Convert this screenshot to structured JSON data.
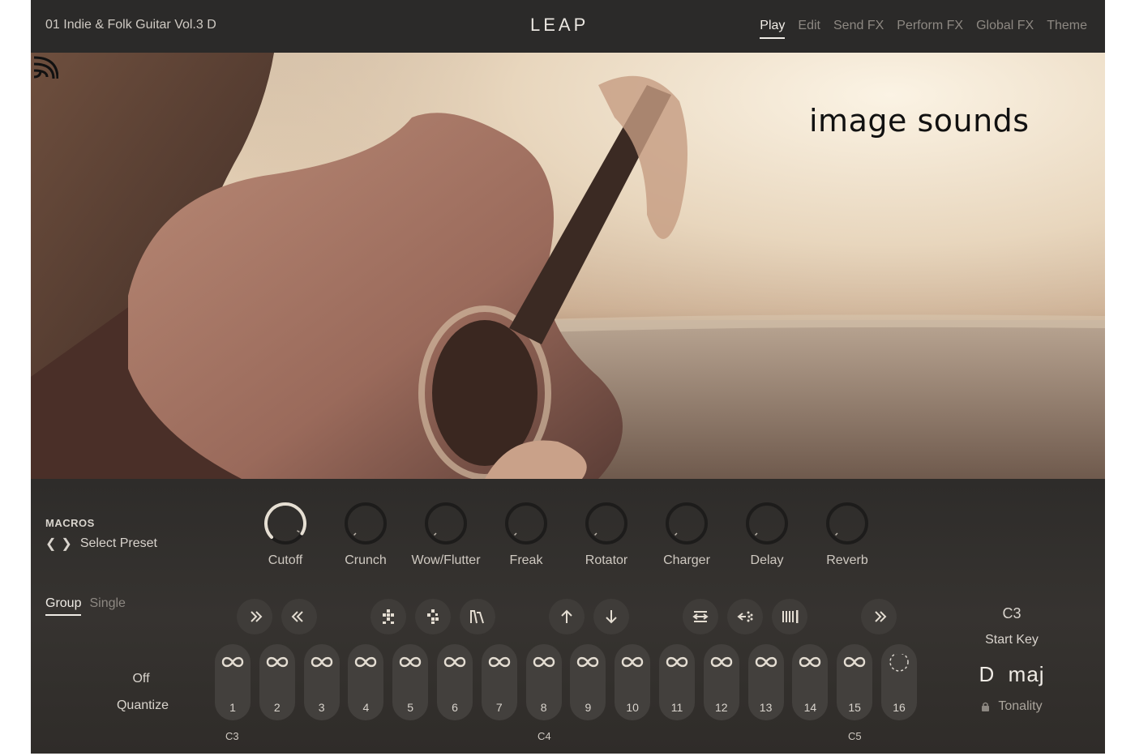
{
  "header": {
    "preset_name": "01 Indie & Folk Guitar Vol.3 D",
    "brand": "LEAP",
    "tabs": [
      {
        "label": "Play"
      },
      {
        "label": "Edit"
      },
      {
        "label": "Send FX"
      },
      {
        "label": "Perform FX"
      },
      {
        "label": "Global FX"
      },
      {
        "label": "Theme"
      }
    ]
  },
  "hero": {
    "logo_text": "image sounds"
  },
  "macros": {
    "title": "MACROS",
    "preset_label": "Select Preset",
    "knobs": [
      {
        "label": "Cutoff",
        "value": 0.95
      },
      {
        "label": "Crunch",
        "value": 0
      },
      {
        "label": "Wow/Flutter",
        "value": 0
      },
      {
        "label": "Freak",
        "value": 0
      },
      {
        "label": "Rotator",
        "value": 0
      },
      {
        "label": "Charger",
        "value": 0
      },
      {
        "label": "Delay",
        "value": 0
      },
      {
        "label": "Reverb",
        "value": 0
      }
    ]
  },
  "mode_tabs": [
    "Group",
    "Single"
  ],
  "quantize": {
    "value": "Off",
    "label": "Quantize"
  },
  "tools": [
    {
      "icon": "skip-forward-icon"
    },
    {
      "icon": "skip-back-icon"
    },
    {
      "icon": "shuffle-pattern-icon"
    },
    {
      "icon": "shuffle-alt-icon"
    },
    {
      "icon": "envelope-icon"
    },
    {
      "icon": "arrow-up-icon"
    },
    {
      "icon": "arrow-down-icon"
    },
    {
      "icon": "reverse-icon"
    },
    {
      "icon": "scatter-icon"
    },
    {
      "icon": "stutter-icon"
    },
    {
      "icon": "skip-forward-icon"
    }
  ],
  "pads": [
    "1",
    "2",
    "3",
    "4",
    "5",
    "6",
    "7",
    "8",
    "9",
    "10",
    "11",
    "12",
    "13",
    "14",
    "15",
    "16"
  ],
  "octave_labels": [
    "C3",
    "C4",
    "C5"
  ],
  "start_key": {
    "value": "C3",
    "label": "Start Key"
  },
  "tonality": {
    "value": "D  maj",
    "label": "Tonality"
  }
}
